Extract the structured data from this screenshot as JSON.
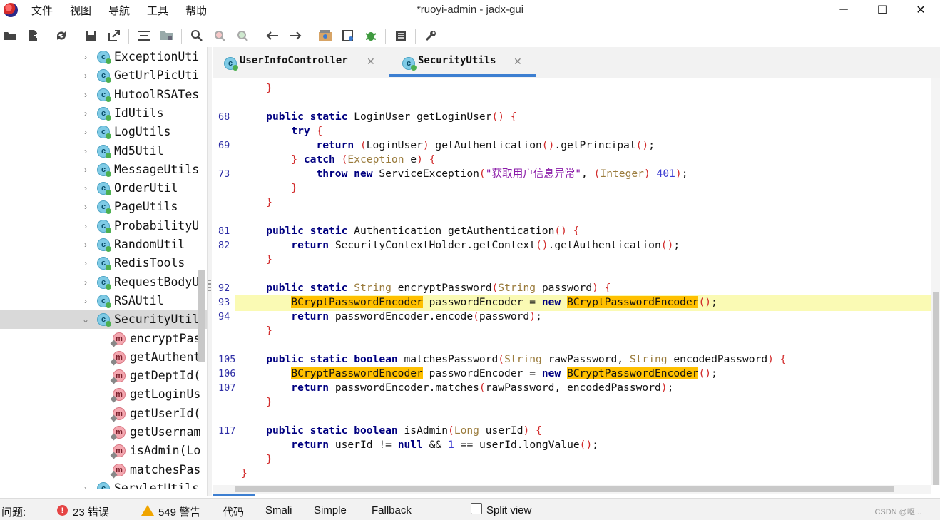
{
  "window": {
    "title": "*ruoyi-admin - jadx-gui",
    "minimize": "─",
    "maximize": "☐",
    "close": "✕"
  },
  "menu": [
    "文件",
    "视图",
    "导航",
    "工具",
    "帮助"
  ],
  "toolbar": {
    "icons": [
      "open-folder-icon",
      "add-files-icon",
      "sync-icon",
      "save-icon",
      "export-icon",
      "flatten-icon",
      "package-icon",
      "search-icon",
      "find-class-icon",
      "find-usage-icon",
      "back-icon",
      "forward-icon",
      "quark-icon",
      "deobfuscate-icon",
      "debug-icon",
      "log-icon",
      "settings-icon"
    ]
  },
  "tree": {
    "items": [
      {
        "label": "ExceptionUti",
        "kind": "class",
        "expanded": false
      },
      {
        "label": "GetUrlPicUti",
        "kind": "class",
        "expanded": false
      },
      {
        "label": "HutoolRSATes",
        "kind": "class",
        "expanded": false
      },
      {
        "label": "IdUtils",
        "kind": "class",
        "expanded": false
      },
      {
        "label": "LogUtils",
        "kind": "class",
        "expanded": false
      },
      {
        "label": "Md5Util",
        "kind": "class",
        "expanded": false
      },
      {
        "label": "MessageUtils",
        "kind": "class",
        "expanded": false
      },
      {
        "label": "OrderUtil",
        "kind": "class",
        "expanded": false
      },
      {
        "label": "PageUtils",
        "kind": "class",
        "expanded": false
      },
      {
        "label": "ProbabilityU",
        "kind": "class",
        "expanded": false
      },
      {
        "label": "RandomUtil",
        "kind": "class",
        "expanded": false
      },
      {
        "label": "RedisTools",
        "kind": "class",
        "expanded": false
      },
      {
        "label": "RequestBodyU",
        "kind": "class",
        "expanded": false
      },
      {
        "label": "RSAUtil",
        "kind": "class",
        "expanded": false
      },
      {
        "label": "SecurityUtil",
        "kind": "class",
        "expanded": true,
        "selected": true
      },
      {
        "label": "encryptPas",
        "kind": "method"
      },
      {
        "label": "getAuthent",
        "kind": "method"
      },
      {
        "label": "getDeptId(",
        "kind": "method"
      },
      {
        "label": "getLoginUs",
        "kind": "method"
      },
      {
        "label": "getUserId(",
        "kind": "method"
      },
      {
        "label": "getUsernam",
        "kind": "method"
      },
      {
        "label": "isAdmin(Lo",
        "kind": "method"
      },
      {
        "label": "matchesPas",
        "kind": "method"
      },
      {
        "label": "ServletUtils",
        "kind": "class",
        "expanded": false
      }
    ]
  },
  "tabs": [
    {
      "label": "UserInfoController",
      "close": "✕",
      "active": false
    },
    {
      "label": "SecurityUtils",
      "close": "✕",
      "active": true
    }
  ],
  "code": {
    "lines": [
      {
        "num": "",
        "text": "    }"
      },
      {
        "num": "",
        "text": ""
      },
      {
        "num": "68",
        "text": "    public static LoginUser getLoginUser() {"
      },
      {
        "num": "",
        "text": "        try {"
      },
      {
        "num": "69",
        "text": "            return (LoginUser) getAuthentication().getPrincipal();"
      },
      {
        "num": "",
        "text": "        } catch (Exception e) {"
      },
      {
        "num": "73",
        "text": "            throw new ServiceException(\"获取用户信息异常\", (Integer) 401);"
      },
      {
        "num": "",
        "text": "        }"
      },
      {
        "num": "",
        "text": "    }"
      },
      {
        "num": "",
        "text": ""
      },
      {
        "num": "81",
        "text": "    public static Authentication getAuthentication() {"
      },
      {
        "num": "82",
        "text": "        return SecurityContextHolder.getContext().getAuthentication();"
      },
      {
        "num": "",
        "text": "    }"
      },
      {
        "num": "",
        "text": ""
      },
      {
        "num": "92",
        "text": "    public static String encryptPassword(String password) {"
      },
      {
        "num": "93",
        "text": "        BCryptPasswordEncoder passwordEncoder = new BCryptPasswordEncoder();"
      },
      {
        "num": "94",
        "text": "        return passwordEncoder.encode(password);"
      },
      {
        "num": "",
        "text": "    }"
      },
      {
        "num": "",
        "text": ""
      },
      {
        "num": "105",
        "text": "    public static boolean matchesPassword(String rawPassword, String encodedPassword) {"
      },
      {
        "num": "106",
        "text": "        BCryptPasswordEncoder passwordEncoder = new BCryptPasswordEncoder();"
      },
      {
        "num": "107",
        "text": "        return passwordEncoder.matches(rawPassword, encodedPassword);"
      },
      {
        "num": "",
        "text": "    }"
      },
      {
        "num": "",
        "text": ""
      },
      {
        "num": "117",
        "text": "    public static boolean isAdmin(Long userId) {"
      },
      {
        "num": "",
        "text": "        return userId != null && 1 == userId.longValue();"
      },
      {
        "num": "",
        "text": "    }"
      },
      {
        "num": "",
        "text": "}"
      }
    ],
    "highlight_word": "BCryptPasswordEncoder",
    "colors": {
      "keyword": "#000080",
      "type": "#9a7b3c",
      "bracket": "#d22b2b",
      "string": "#8a1aa8",
      "number": "#3b3bd1",
      "highlight": "#ffc000",
      "current_line": "#fafab4"
    }
  },
  "statusbar": {
    "problems_label": "问题:",
    "errors": "23 错误",
    "warnings": "549 警告",
    "view_tabs": [
      "代码",
      "Smali",
      "Simple",
      "Fallback"
    ],
    "split_view": "Split view",
    "watermark": "CSDN @呕..."
  }
}
